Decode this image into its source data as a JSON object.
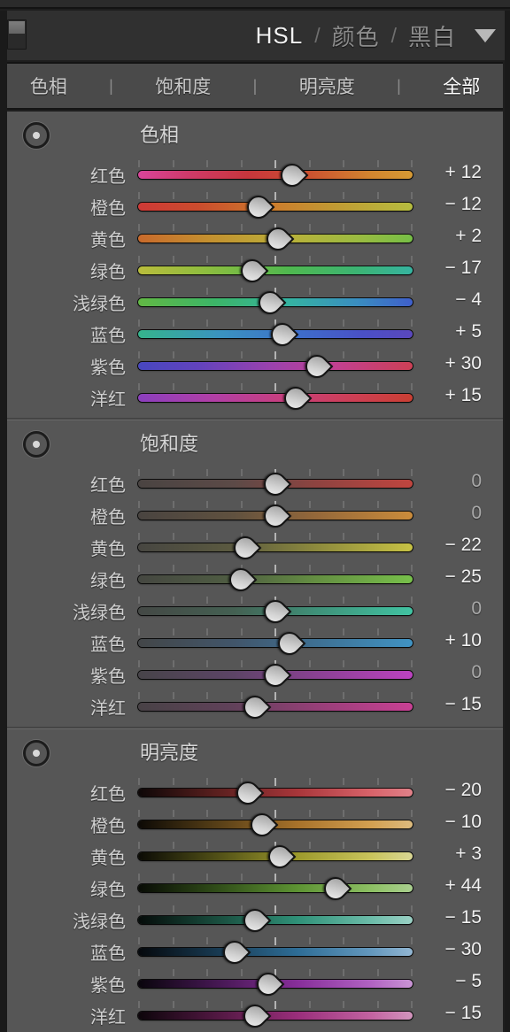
{
  "window": {
    "panel_switch_icon": "panel-toggle-icon"
  },
  "header": {
    "titles": [
      {
        "label": "HSL",
        "active": true
      },
      {
        "label": "颜色",
        "active": false
      },
      {
        "label": "黑白",
        "active": false
      }
    ],
    "separator": "/",
    "disclosure_icon": "chevron-down-icon"
  },
  "tabs": [
    {
      "label": "色相",
      "active": false
    },
    {
      "label": "饱和度",
      "active": false
    },
    {
      "label": "明亮度",
      "active": false
    },
    {
      "label": "全部",
      "active": true
    }
  ],
  "tab_separator": "|",
  "colors": {
    "panel_bg": "#565656",
    "header_bg": "#303030",
    "tabbar_bg": "#4a4a4a",
    "outer_border": "#1a1a1a",
    "text": "#cfcfcf",
    "text_active": "#ffffff",
    "value_zero": "#a8a8a8",
    "tick": "#6e6e6e",
    "tick_mid": "#b3b3b3"
  },
  "slider_range": {
    "min": -100,
    "max": 100,
    "ticks": 9
  },
  "sections": [
    {
      "id": "hue",
      "title": "色相",
      "target_icon": "target-adjust-icon",
      "rows": [
        {
          "label": "红色",
          "value": 12,
          "display": "+ 12",
          "gradient": "linear-gradient(90deg,#d9449a 0%,#cf3a6a 18%,#c8363c 40%,#cc5130 62%,#d2862f 85%,#d69a34 100%)"
        },
        {
          "label": "橙色",
          "value": -12,
          "display": "− 12",
          "gradient": "linear-gradient(90deg,#cf3936 0%,#cb4c2d 22%,#cd7b2c 48%,#c19b33 72%,#b6bd3f 100%)"
        },
        {
          "label": "黄色",
          "value": 2,
          "display": "+ 2",
          "gradient": "linear-gradient(90deg,#c96a2c 0%,#c48f2f 25%,#bab13a 55%,#9bbb41 80%,#76bf46 100%)"
        },
        {
          "label": "绿色",
          "value": -17,
          "display": "− 17",
          "gradient": "linear-gradient(90deg,#b9bc3c 0%,#8dbd3f 25%,#4fb84f 55%,#3cb474 80%,#36b4a0 100%)"
        },
        {
          "label": "浅绿色",
          "value": -4,
          "display": "− 4",
          "gradient": "linear-gradient(90deg,#62b844 0%,#3cb568 28%,#35b3a2 55%,#3a8dc0 80%,#3f5fcb 100%)"
        },
        {
          "label": "蓝色",
          "value": 5,
          "display": "+ 5",
          "gradient": "linear-gradient(90deg,#35b48c 0%,#3a93c0 30%,#3e6ccb 60%,#4a50c6 82%,#5a47bd 100%)"
        },
        {
          "label": "紫色",
          "value": 30,
          "display": "+ 30",
          "gradient": "linear-gradient(90deg,#4747bf 0%,#6243bd 22%,#9a42ae 48%,#c24091 72%,#cc4055 100%)"
        },
        {
          "label": "洋红",
          "value": 15,
          "display": "+ 15",
          "gradient": "linear-gradient(90deg,#8b3fbe 0%,#b23fa5 28%,#c93f7b 55%,#cd3f52 80%,#ca3f33 100%)"
        }
      ]
    },
    {
      "id": "saturation",
      "title": "饱和度",
      "target_icon": "target-adjust-icon",
      "rows": [
        {
          "label": "红色",
          "value": 0,
          "display": "0",
          "zero": true,
          "gradient": "linear-gradient(90deg,#4a4442 0%,#5c4a47 35%,#8e4340 65%,#c0453f 100%)"
        },
        {
          "label": "橙色",
          "value": 0,
          "display": "0",
          "zero": true,
          "gradient": "linear-gradient(90deg,#494440 0%,#60513f 35%,#95683a 65%,#cb8c3b 100%)"
        },
        {
          "label": "黄色",
          "value": -22,
          "display": "− 22",
          "gradient": "linear-gradient(90deg,#474641 0%,#5b5a40 35%,#8d8a3d 65%,#c7c244 100%)"
        },
        {
          "label": "绿色",
          "value": -25,
          "display": "− 25",
          "gradient": "linear-gradient(90deg,#454741 0%,#4f5d42 35%,#648f42 65%,#77c04a 100%)"
        },
        {
          "label": "浅绿色",
          "value": 0,
          "display": "0",
          "zero": true,
          "gradient": "linear-gradient(90deg,#444845 0%,#446052 35%,#3f9179 65%,#41c3a2 100%)"
        },
        {
          "label": "蓝色",
          "value": 10,
          "display": "+ 10",
          "gradient": "linear-gradient(90deg,#434648 0%,#41556a 35%,#3e7093 65%,#4093c3 100%)"
        },
        {
          "label": "紫色",
          "value": 0,
          "display": "0",
          "zero": true,
          "gradient": "linear-gradient(90deg,#474449 0%,#5c4466 35%,#8a4193 65%,#bb42c0 100%)"
        },
        {
          "label": "洋红",
          "value": -15,
          "display": "− 15",
          "gradient": "linear-gradient(90deg,#484246 0%,#61415a 35%,#963f78 65%,#c94094 100%)"
        }
      ]
    },
    {
      "id": "luminance",
      "title": "明亮度",
      "target_icon": "target-adjust-icon",
      "rows": [
        {
          "label": "红色",
          "value": -20,
          "display": "− 20",
          "gradient": "linear-gradient(90deg,#0d0707 0%,#591f1e 28%,#a8363a 58%,#d8636a 85%,#e08189 100%)"
        },
        {
          "label": "橙色",
          "value": -10,
          "display": "− 10",
          "gradient": "linear-gradient(90deg,#0c0905 0%,#543d16 28%,#a8722a 58%,#d3a051 85%,#ddbb7e 100%)"
        },
        {
          "label": "黄色",
          "value": 3,
          "display": "+ 3",
          "gradient": "linear-gradient(90deg,#0b0b05 0%,#4e4d16 28%,#9d9a2c 58%,#c9c45c 85%,#d9d694 100%)"
        },
        {
          "label": "绿色",
          "value": 44,
          "display": "+ 44",
          "gradient": "linear-gradient(90deg,#080b05 0%,#2f4b18 28%,#5d9333 58%,#8dc064 85%,#aacf8f 100%)"
        },
        {
          "label": "浅绿色",
          "value": -15,
          "display": "− 15",
          "gradient": "linear-gradient(90deg,#050b09 0%,#184b3c 28%,#2f9178 58%,#6cbca9 85%,#9ad0c4 100%)"
        },
        {
          "label": "蓝色",
          "value": -30,
          "display": "− 30",
          "gradient": "linear-gradient(90deg,#05080c 0%,#17384f 28%,#2e6d96 58%,#6498bd 85%,#92b6d2 100%)"
        },
        {
          "label": "紫色",
          "value": -5,
          "display": "− 5",
          "gradient": "linear-gradient(90deg,#09050c 0%,#431750 28%,#872e9a 58%,#b163c2 85%,#c995d5 100%)"
        },
        {
          "label": "洋红",
          "value": -15,
          "display": "− 15",
          "gradient": "linear-gradient(90deg,#0c050a 0%,#4f1740 28%,#9a2e7b 58%,#c263a1 85%,#d295bd 100%)"
        }
      ]
    }
  ]
}
